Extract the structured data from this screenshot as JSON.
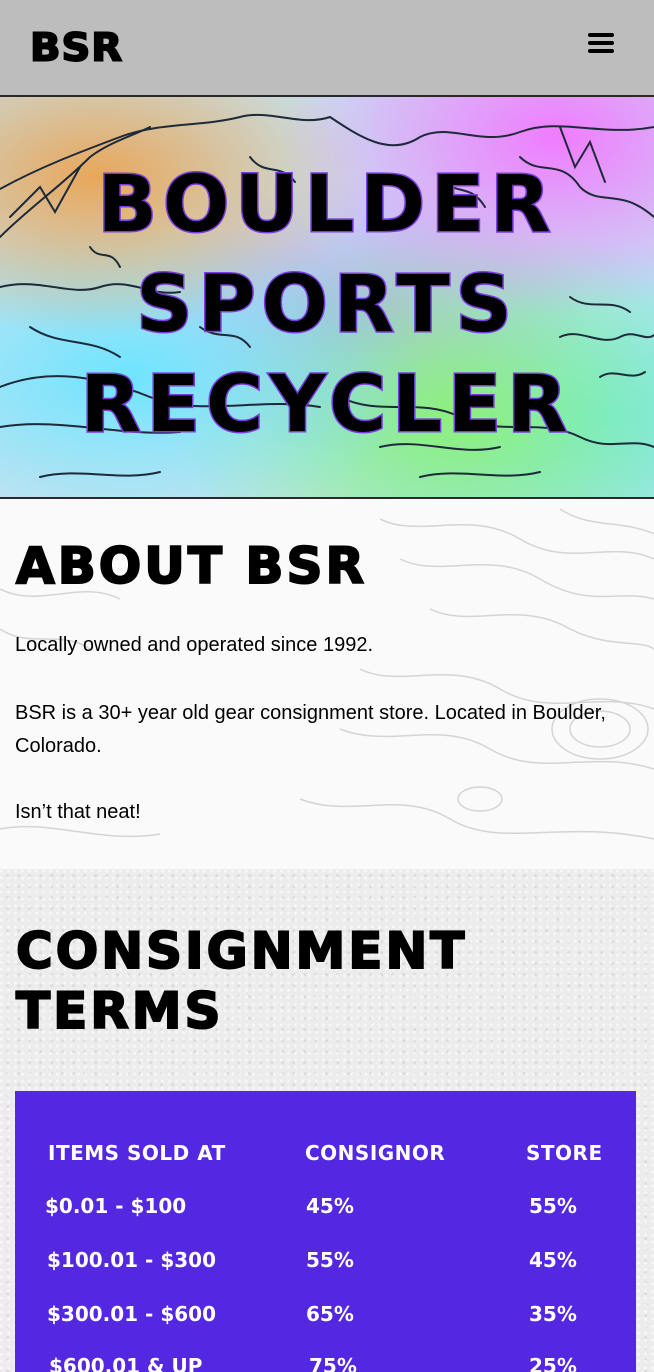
{
  "header": {
    "logo": "BSR",
    "menu_icon": "hamburger-menu-icon"
  },
  "hero": {
    "title_lines": [
      "BOULDER",
      "SPORTS",
      "RECYCLER"
    ]
  },
  "about": {
    "heading": "ABOUT BSR",
    "paragraphs": [
      "Locally owned and operated since 1992.",
      "BSR is a 30+ year old gear consignment store. Located in Boulder, Colorado.",
      "Isn’t that neat!"
    ]
  },
  "terms": {
    "heading": "CONSIGNMENT TERMS",
    "table": {
      "headers": [
        "ITEMS SOLD AT",
        "CONSIGNOR",
        "STORE"
      ],
      "rows": [
        [
          "$0.01 - $100",
          "45%",
          "55%"
        ],
        [
          "$100.01 - $300",
          "55%",
          "45%"
        ],
        [
          "$300.01 - $600",
          "65%",
          "35%"
        ],
        [
          "$600.01 & UP",
          "75%",
          "25%"
        ]
      ]
    }
  },
  "colors": {
    "header_bg": "#bdbdbd",
    "table_bg": "#5427e0",
    "title_outline": "#7a3ce0"
  }
}
